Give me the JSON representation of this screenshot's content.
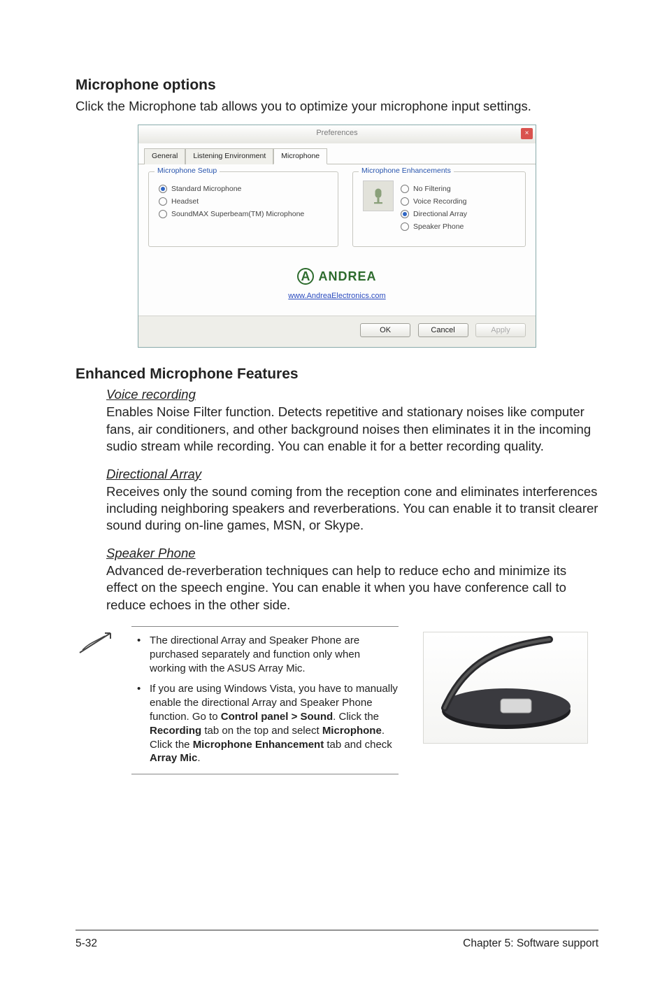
{
  "section1": {
    "title": "Microphone options",
    "text": "Click the Microphone tab allows you to optimize your microphone input settings."
  },
  "dialog": {
    "title": "Preferences",
    "close_glyph": "×",
    "tabs": {
      "general": "General",
      "listening": "Listening Environment",
      "microphone": "Microphone"
    },
    "left_group": {
      "legend": "Microphone Setup",
      "options": {
        "std": "Standard Microphone",
        "headset": "Headset",
        "soundmax": "SoundMAX Superbeam(TM) Microphone"
      }
    },
    "right_group": {
      "legend": "Microphone Enhancements",
      "options": {
        "no_filter": "No Filtering",
        "voice_rec": "Voice Recording",
        "dir_array": "Directional Array",
        "spk_phone": "Speaker Phone"
      }
    },
    "andrea": {
      "logo_text": "ANDREA",
      "link": "www.AndreaElectronics.com"
    },
    "buttons": {
      "ok": "OK",
      "cancel": "Cancel",
      "apply": "Apply"
    }
  },
  "section2": {
    "title": "Enhanced Microphone Features",
    "voice_head": "Voice recording",
    "voice_body": "Enables Noise Filter function. Detects repetitive and stationary noises like computer fans, air conditioners, and other background noises then eliminates it in the incoming sudio stream while recording. You can enable it for a better recording quality.",
    "dir_head": "Directional Array",
    "dir_body": "Receives only the sound coming from the reception cone and eliminates interferences including neighboring speakers and reverberations. You can enable it to transit clearer sound during on-line games, MSN, or Skype.",
    "spk_head": "Speaker Phone",
    "spk_body": "Advanced de-reverberation techniques can help to reduce echo and minimize its effect on the speech engine. You can enable it when you have conference call to reduce echoes in the other side."
  },
  "notes": {
    "item1": "The directional Array and Speaker Phone are purchased separately and function only when working with the ASUS Array Mic.",
    "item2_a": "If you are using Windows Vista, you have to manually enable the directional Array and Speaker Phone function. Go to ",
    "item2_b": "Control panel > Sound",
    "item2_c": ". Click the ",
    "item2_d": "Recording",
    "item2_e": " tab on the top and select ",
    "item2_f": "Microphone",
    "item2_g": ". Click the ",
    "item2_h": "Microphone Enhancement",
    "item2_i": " tab and check ",
    "item2_j": "Array Mic",
    "item2_k": "."
  },
  "footer": {
    "left": "5-32",
    "right": "Chapter 5: Software support"
  }
}
